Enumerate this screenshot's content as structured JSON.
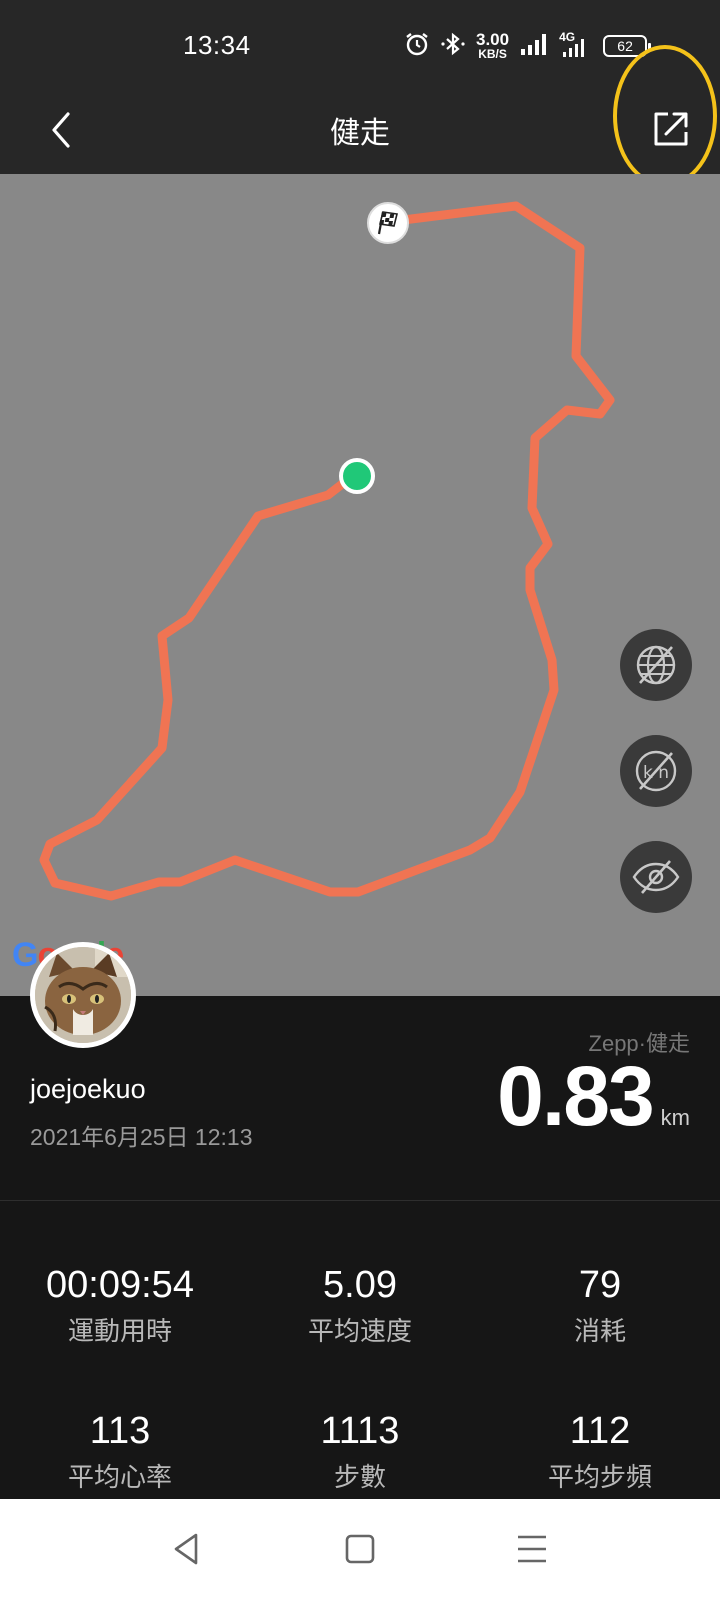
{
  "status_bar": {
    "time": "13:34",
    "net_speed_value": "3.00",
    "net_speed_unit": "KB/S",
    "network_type": "4G",
    "battery": "62",
    "icons": [
      "alarm-icon",
      "bluetooth-icon",
      "signal-icon",
      "battery-icon"
    ]
  },
  "header": {
    "title": "健走",
    "back_icon": "chevron-left-icon",
    "share_icon": "share-external-icon",
    "highlight_color": "#f4c21a"
  },
  "map": {
    "route_color": "#f07453",
    "start_marker_color": "#20c878",
    "end_marker_icon": "checkered-flag-icon",
    "attribution": [
      "G",
      "o",
      "o",
      "g",
      "l",
      "e"
    ],
    "controls": [
      "globe-off-icon",
      "km-off-icon",
      "eye-off-icon"
    ]
  },
  "summary": {
    "brand": "Zepp·健走",
    "username": "joejoekuo",
    "datetime": "2021年6月25日 12:13",
    "distance_value": "0.83",
    "distance_unit": "km"
  },
  "stats": [
    {
      "value": "00:09:54",
      "label": "運動用時"
    },
    {
      "value": "5.09",
      "label": "平均速度"
    },
    {
      "value": "79",
      "label": "消耗"
    },
    {
      "value": "113",
      "label": "平均心率"
    },
    {
      "value": "1113",
      "label": "步數"
    },
    {
      "value": "112",
      "label": "平均步頻"
    }
  ],
  "nav_bar": {
    "icons": [
      "back-triangle-icon",
      "home-square-icon",
      "menu-lines-icon"
    ]
  }
}
